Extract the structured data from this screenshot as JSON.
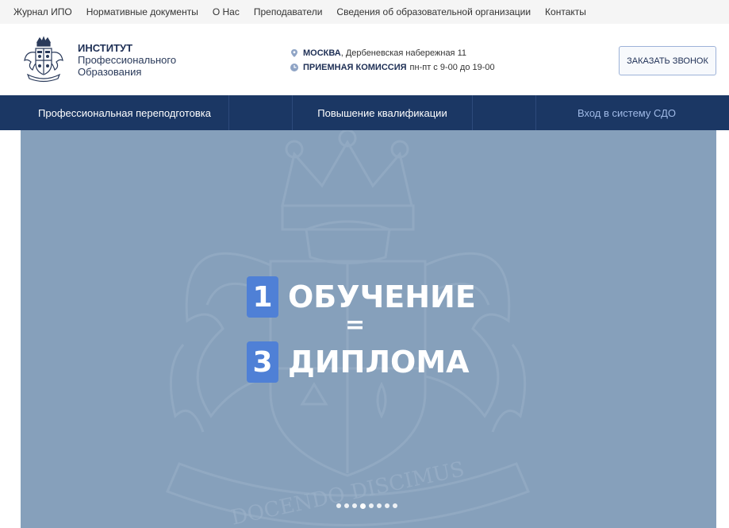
{
  "top_nav": {
    "items": [
      "Журнал ИПО",
      "Нормативные документы",
      "О Нас",
      "Преподаватели",
      "Сведения об образовательной организации",
      "Контакты"
    ]
  },
  "header": {
    "brand_line1": "ИНСТИТУТ",
    "brand_line2": "Профессионального",
    "brand_line3": "Образования",
    "city": "МОСКВА",
    "address": ", Дербеневская набережная 11",
    "admissions_label": "ПРИЕМНАЯ КОМИССИЯ",
    "admissions_hours": "пн-пт с 9-00 до 19-00",
    "call_button": "ЗАКАЗАТЬ ЗВОНОК",
    "crest_motto": "DOCENDO DISCIMUS"
  },
  "main_menu": {
    "items": [
      "Профессиональная переподготовка",
      "Повышение квалификации",
      "Вход в систему СДО"
    ]
  },
  "hero": {
    "num1": "1",
    "word1": "ОБУЧЕНИЕ",
    "equals": "=",
    "num2": "3",
    "word2": "ДИПЛОМА",
    "motto": "DOCENDO DISCIMUS",
    "slide_count": 8,
    "active_slide": 4
  },
  "colors": {
    "nav_bg": "#1b3764",
    "hero_bg": "#86a0bb",
    "accent": "#4f80d6",
    "sdo_link": "#9fb9e6"
  }
}
